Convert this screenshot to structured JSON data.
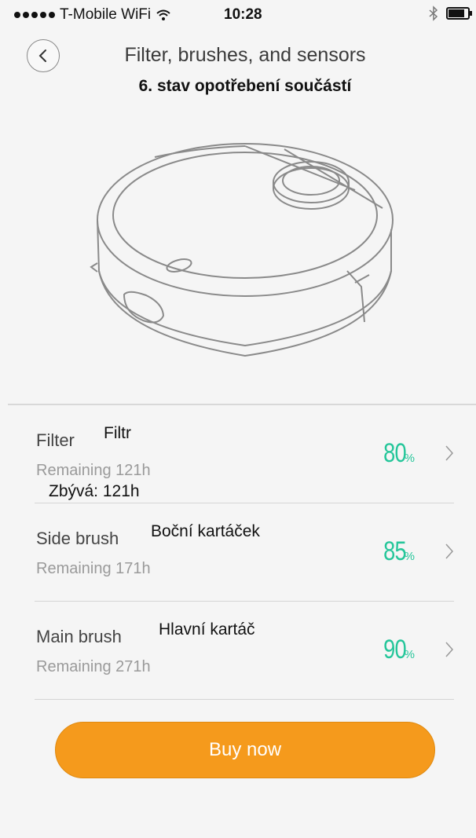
{
  "status": {
    "carrier": "T-Mobile WiFi",
    "time": "10:28",
    "battery_level": 0.9
  },
  "nav": {
    "title": "Filter, brushes, and sensors",
    "subtitle": "6. stav opotřebení součástí"
  },
  "items": [
    {
      "name": "Filter",
      "name_cz": "Filtr",
      "remaining": "Remaining 121h",
      "remaining_cz": "Zbývá: 121h",
      "percent": "80",
      "unit": "%"
    },
    {
      "name": "Side brush",
      "name_cz": "Boční kartáček",
      "remaining": "Remaining 171h",
      "percent": "85",
      "unit": "%"
    },
    {
      "name": "Main brush",
      "name_cz": "Hlavní kartáč",
      "remaining": "Remaining 271h",
      "percent": "90",
      "unit": "%"
    }
  ],
  "buy_button": "Buy now",
  "colors": {
    "accent": "#f59a1c",
    "percent": "#25c69a"
  },
  "icons": [
    "back-icon",
    "chevron-right-icon",
    "wifi-icon",
    "bluetooth-icon",
    "battery-icon",
    "robot-vacuum-illustration"
  ]
}
